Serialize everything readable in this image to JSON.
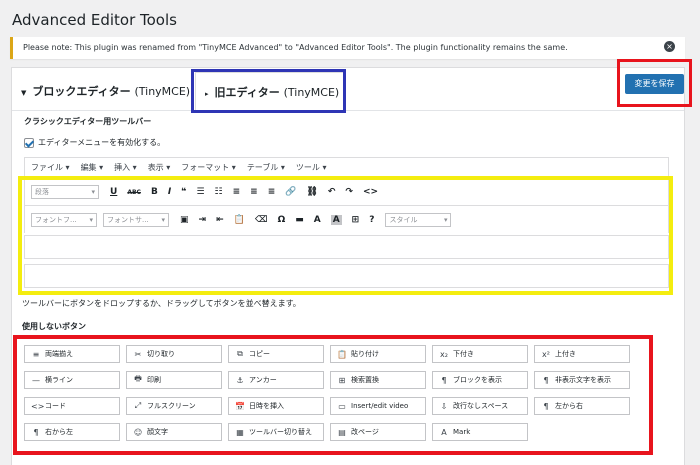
{
  "page": {
    "title": "Advanced Editor Tools"
  },
  "notice": {
    "text": "Please note: This plugin was renamed from \"TinyMCE Advanced\" to \"Advanced Editor Tools\". The plugin functionality remains the same.",
    "close_icon": "×"
  },
  "tabs": [
    {
      "label": "ブロックエディター",
      "suffix": "(TinyMCE)"
    },
    {
      "label": "旧エディター",
      "suffix": "(TinyMCE)"
    }
  ],
  "save_button": {
    "label": "変更を保存"
  },
  "classic": {
    "section_label": "クラシックエディター用ツールバー",
    "enable_menu_label": "エディターメニューを有効化する。"
  },
  "menubar": [
    "ファイル ▾",
    "編集 ▾",
    "挿入 ▾",
    "表示 ▾",
    "フォーマット ▾",
    "テーブル ▾",
    "ツール ▾"
  ],
  "toolbar1": {
    "format_select": "段落",
    "icons": [
      "U",
      "ABC",
      "B",
      "I",
      "❝",
      "☰",
      "☷",
      "≡",
      "≡",
      "≡",
      "🔗",
      "⛓",
      "↶",
      "↷",
      "<>"
    ]
  },
  "toolbar2": {
    "font_family": "フォントフ...",
    "font_size": "フォントサ...",
    "style_select": "スタイル",
    "icons": [
      "▣",
      "⇥",
      "⇤",
      "📋",
      "⌫",
      "Ω",
      "▬",
      "A",
      "A",
      "⊞",
      "?"
    ]
  },
  "hint_text": "ツールバーにボタンをドロップするか、ドラッグしてボタンを並べ替えます。",
  "unused": {
    "label": "使用しないボタン",
    "buttons": [
      {
        "icon": "≡",
        "label": "両端揃え"
      },
      {
        "icon": "✂",
        "label": "切り取り"
      },
      {
        "icon": "⧉",
        "label": "コピー"
      },
      {
        "icon": "📋",
        "label": "貼り付け"
      },
      {
        "icon": "x₂",
        "label": "下付き"
      },
      {
        "icon": "x²",
        "label": "上付き"
      },
      {
        "icon": "—",
        "label": "横ライン"
      },
      {
        "icon": "🖶",
        "label": "印刷"
      },
      {
        "icon": "⚓",
        "label": "アンカー"
      },
      {
        "icon": "⊞",
        "label": "検索置換"
      },
      {
        "icon": "¶",
        "label": "ブロックを表示"
      },
      {
        "icon": "¶",
        "label": "非表示文字を表示"
      },
      {
        "icon": "<>",
        "label": "コード"
      },
      {
        "icon": "⤢",
        "label": "フルスクリーン"
      },
      {
        "icon": "📅",
        "label": "日時を挿入"
      },
      {
        "icon": "▭",
        "label": "Insert/edit video"
      },
      {
        "icon": "⇩",
        "label": "改行なしスペース"
      },
      {
        "icon": "¶",
        "label": "左から右"
      },
      {
        "icon": "¶",
        "label": "右から左"
      },
      {
        "icon": "☺",
        "label": "顔文字"
      },
      {
        "icon": "▦",
        "label": "ツールバー切り替え"
      },
      {
        "icon": "▤",
        "label": "改ページ"
      },
      {
        "icon": "A",
        "label": "Mark"
      }
    ]
  }
}
